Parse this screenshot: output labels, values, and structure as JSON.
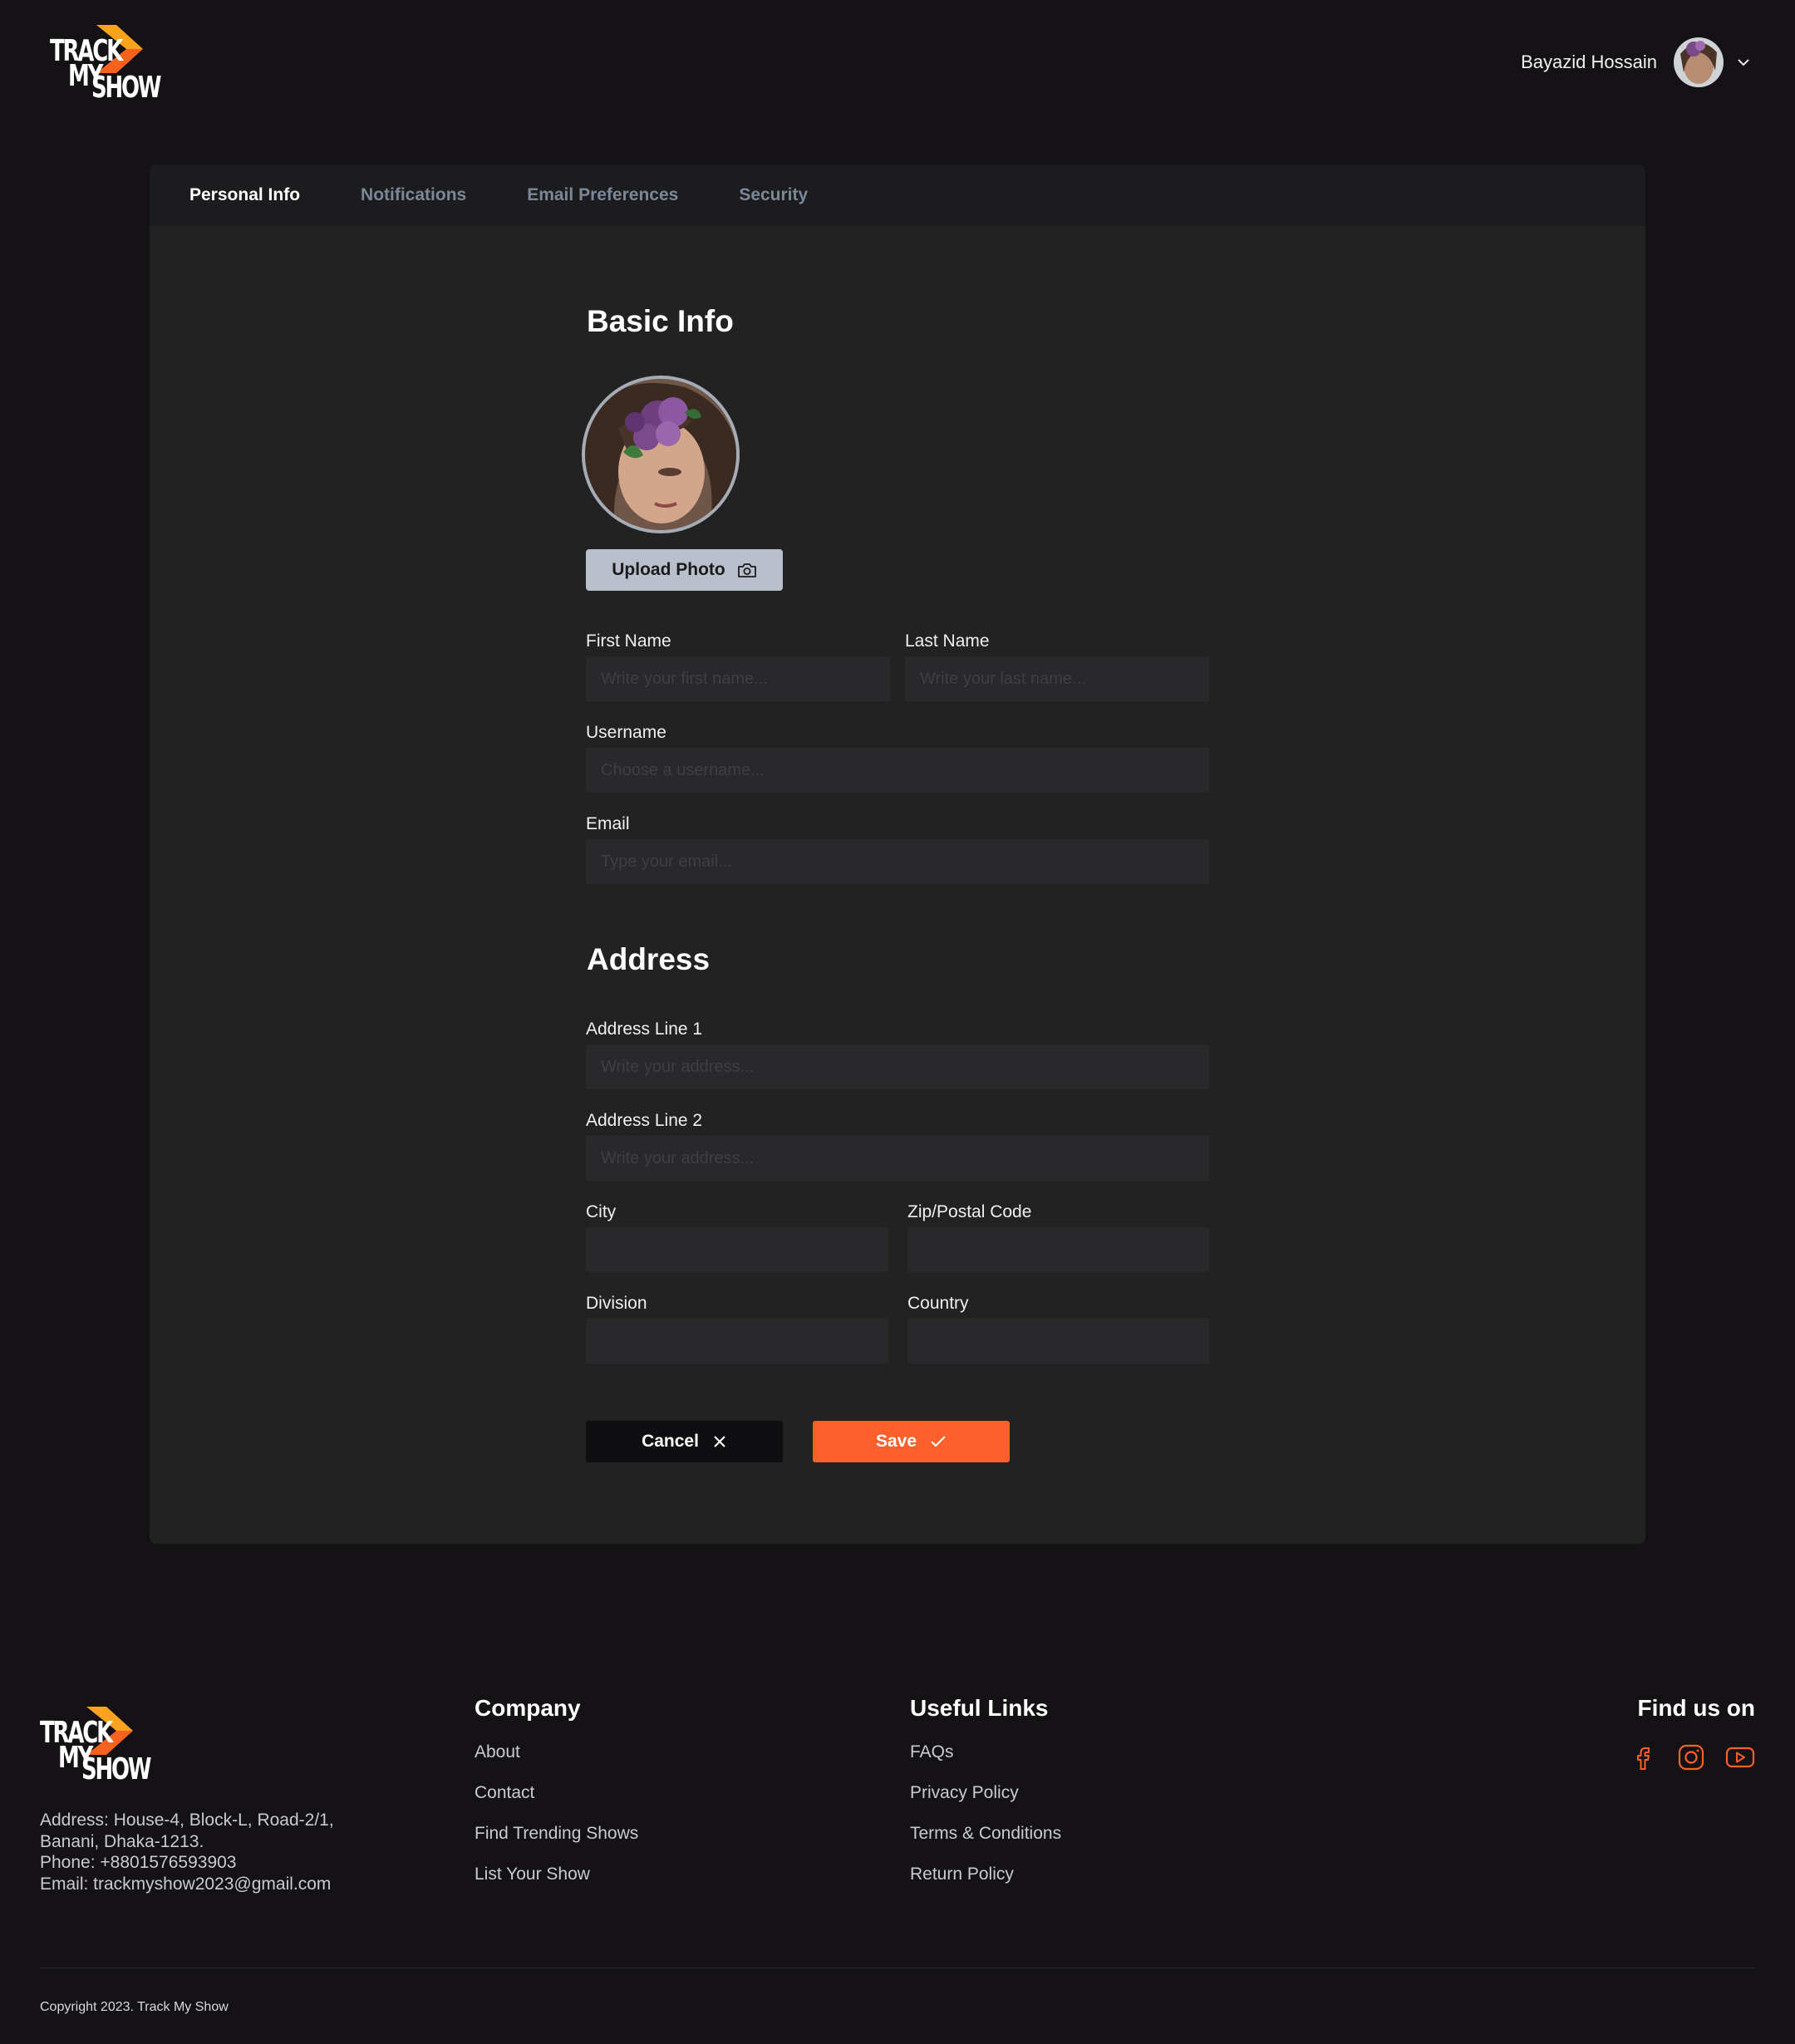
{
  "brand": {
    "logo_line1": "TRACK",
    "logo_line2": "MY",
    "logo_line3": "SHOW",
    "accent_color": "#fb5f2a",
    "logo_orange": "#f77a1c",
    "logo_yellow": "#fca31d"
  },
  "header": {
    "user_name": "Bayazid Hossain",
    "avatar_icon": "user-avatar",
    "menu_icon": "chevron-down-icon"
  },
  "tabs": [
    {
      "label": "Personal Info",
      "active": true
    },
    {
      "label": "Notifications",
      "active": false
    },
    {
      "label": "Email Preferences",
      "active": false
    },
    {
      "label": "Security",
      "active": false
    }
  ],
  "basic_info": {
    "title": "Basic Info",
    "upload_label": "Upload Photo",
    "upload_icon": "camera-icon",
    "first_name": {
      "label": "First Name",
      "placeholder": "Write your first name...",
      "value": ""
    },
    "last_name": {
      "label": "Last Name",
      "placeholder": "Write your last name...",
      "value": ""
    },
    "username": {
      "label": "Username",
      "placeholder": "Choose a username...",
      "value": ""
    },
    "email": {
      "label": "Email",
      "placeholder": "Type your email...",
      "value": ""
    }
  },
  "address": {
    "title": "Address",
    "line1": {
      "label": "Address Line 1",
      "placeholder": "Write your address...",
      "value": ""
    },
    "line2": {
      "label": "Address Line 2",
      "placeholder": "Write your address...",
      "value": ""
    },
    "city": {
      "label": "City",
      "placeholder": "",
      "value": ""
    },
    "zip": {
      "label": "Zip/Postal Code",
      "placeholder": "",
      "value": ""
    },
    "division": {
      "label": "Division",
      "placeholder": "",
      "value": ""
    },
    "country": {
      "label": "Country",
      "placeholder": "",
      "value": ""
    }
  },
  "actions": {
    "cancel_label": "Cancel",
    "cancel_icon": "close-icon",
    "save_label": "Save",
    "save_icon": "check-icon"
  },
  "footer": {
    "address_line1": "Address: House-4, Block-L, Road-2/1,",
    "address_line2": "Banani, Dhaka-1213.",
    "phone": "Phone:  +8801576593903",
    "email": "Email:  trackmyshow2023@gmail.com",
    "company": {
      "title": "Company",
      "links": [
        "About",
        "Contact",
        "Find Trending Shows",
        "List Your Show"
      ]
    },
    "useful_links": {
      "title": "Useful Links",
      "links": [
        "FAQs",
        "Privacy Policy",
        "Terms & Conditions",
        "Return Policy"
      ]
    },
    "find_us": {
      "title": "Find us on",
      "icons": [
        "facebook-icon",
        "instagram-icon",
        "youtube-icon"
      ]
    },
    "copyright": "Copyright 2023. Track My Show"
  }
}
